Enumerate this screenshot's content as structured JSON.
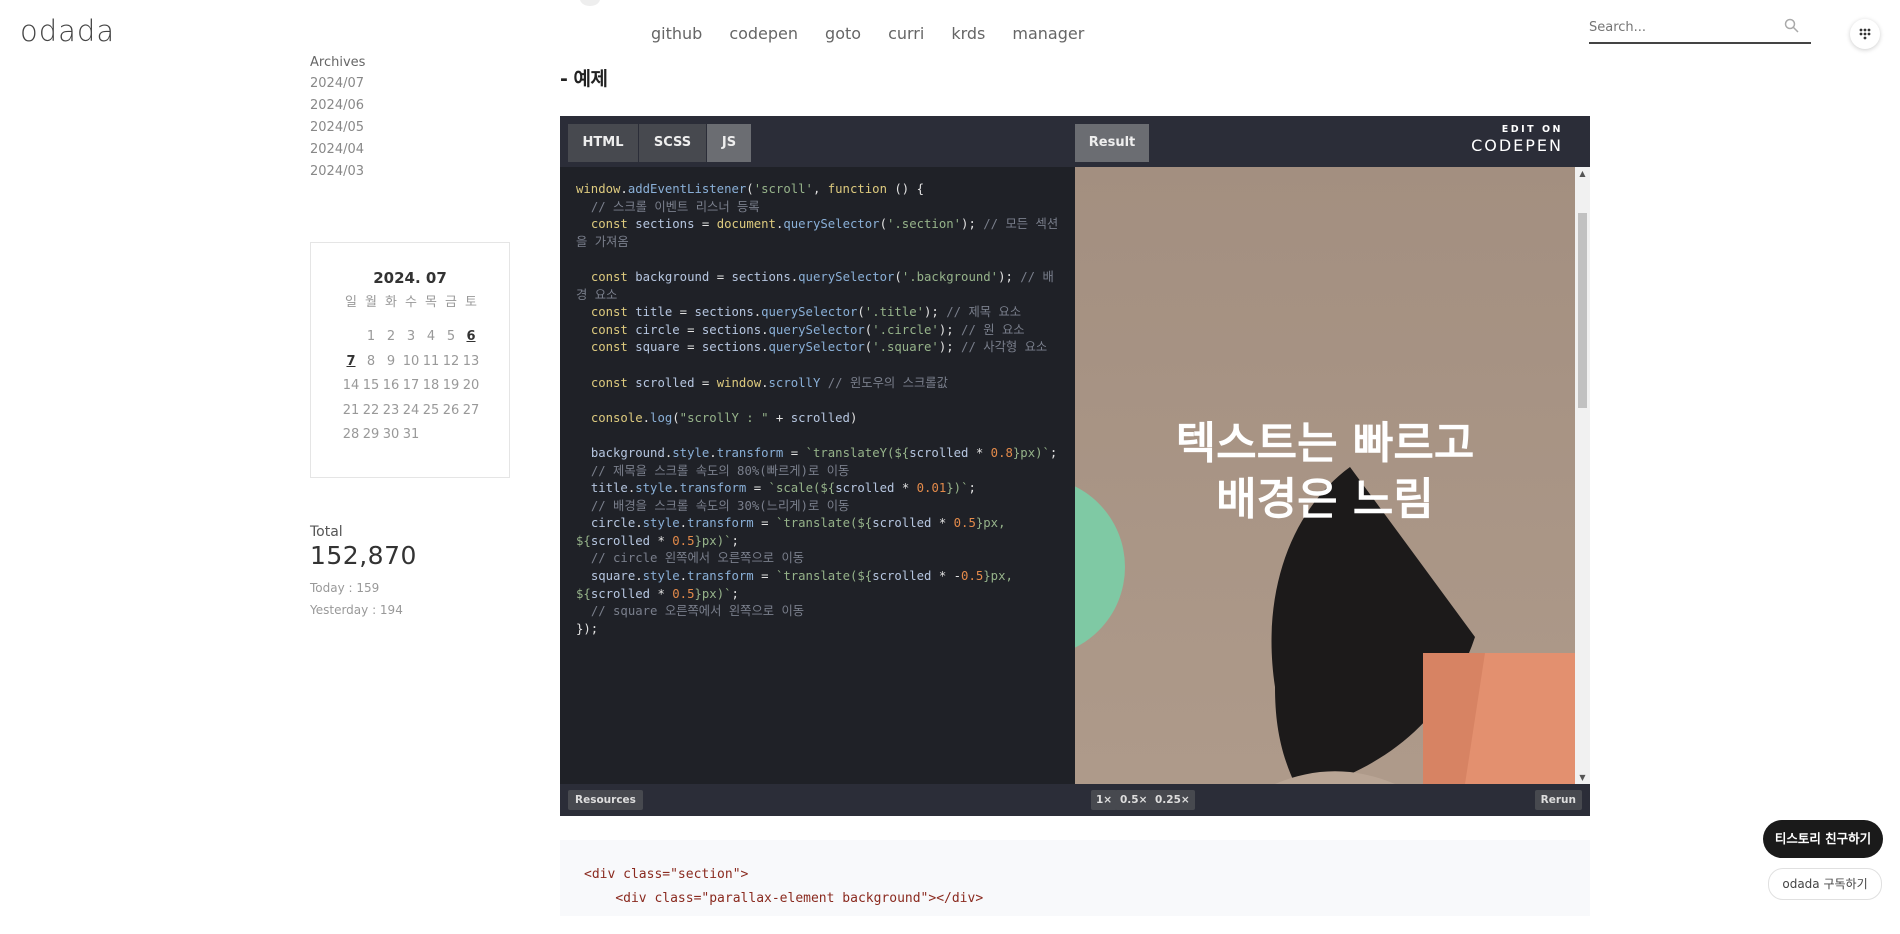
{
  "header": {
    "logo": "odada",
    "nav": [
      "github",
      "codepen",
      "goto",
      "curri",
      "krds",
      "manager"
    ],
    "search_placeholder": "Search..."
  },
  "sidebar": {
    "archives_title": "Archives",
    "archives": [
      "2024/07",
      "2024/06",
      "2024/05",
      "2024/04",
      "2024/03"
    ],
    "calendar": {
      "title": "2024. 07",
      "weekdays": [
        "일",
        "월",
        "화",
        "수",
        "목",
        "금",
        "토"
      ],
      "weeks": [
        [
          "",
          "1",
          "2",
          "3",
          "4",
          "5",
          "6"
        ],
        [
          "7",
          "8",
          "9",
          "10",
          "11",
          "12",
          "13"
        ],
        [
          "14",
          "15",
          "16",
          "17",
          "18",
          "19",
          "20"
        ],
        [
          "21",
          "22",
          "23",
          "24",
          "25",
          "26",
          "27"
        ],
        [
          "28",
          "29",
          "30",
          "31",
          "",
          "",
          ""
        ]
      ],
      "highlighted": [
        "6",
        "7"
      ]
    },
    "counter": {
      "label": "Total",
      "total": "152,870",
      "today": "Today : 159",
      "yesterday": "Yesterday : 194"
    }
  },
  "main": {
    "heading": "- 예제",
    "pen": {
      "tabs": [
        "HTML",
        "SCSS",
        "JS"
      ],
      "active_tab": "JS",
      "result_tab": "Result",
      "edit_on_line1": "EDIT ON",
      "edit_on_line2": "CODEPEN",
      "result_text_line1": "텍스트는 빠르고",
      "result_text_line2": "배경은 느림",
      "bottom_left": "Resources",
      "zoom": [
        "1×",
        "0.5×",
        "0.25×"
      ],
      "rerun": "Rerun"
    },
    "code_block": {
      "line1_tag": "<div class=\"section\">",
      "line2_tag": "<div class=\"parallax-element background\"></div>"
    }
  },
  "floating": {
    "invite": "티스토리 친구하기",
    "subscribe": "odada 구독하기"
  },
  "colors": {
    "accent_dark": "#1e1f26",
    "result_bg": "#a89484",
    "circle_green": "#7fc9a4",
    "square_orange": "#e3906f"
  }
}
